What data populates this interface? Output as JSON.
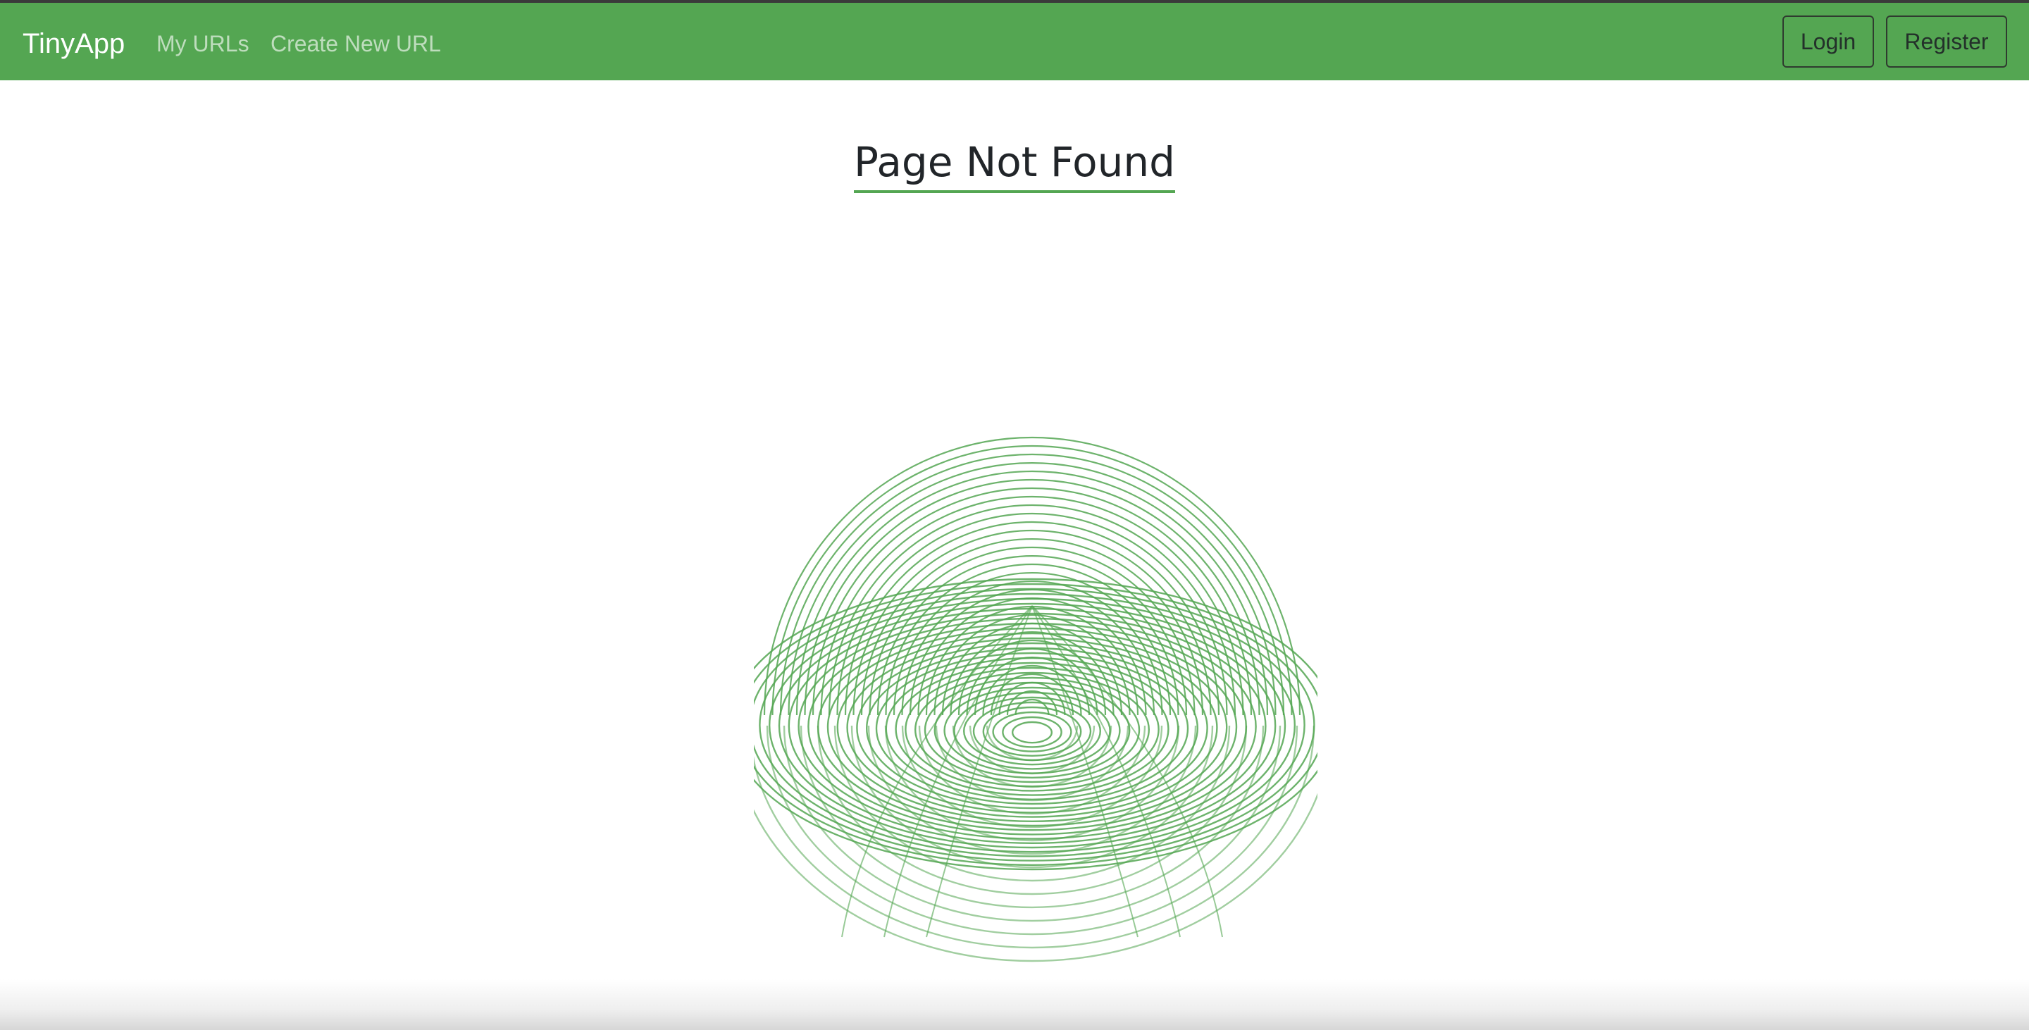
{
  "navbar": {
    "brand": "TinyApp",
    "links": [
      "My URLs",
      "Create New URL"
    ],
    "login_label": "Login",
    "register_label": "Register",
    "background_color": "#54a652"
  },
  "main": {
    "title": "Page Not Found",
    "illustration_icon": "green-sphere-rings-icon",
    "accent_color": "#54a652"
  }
}
